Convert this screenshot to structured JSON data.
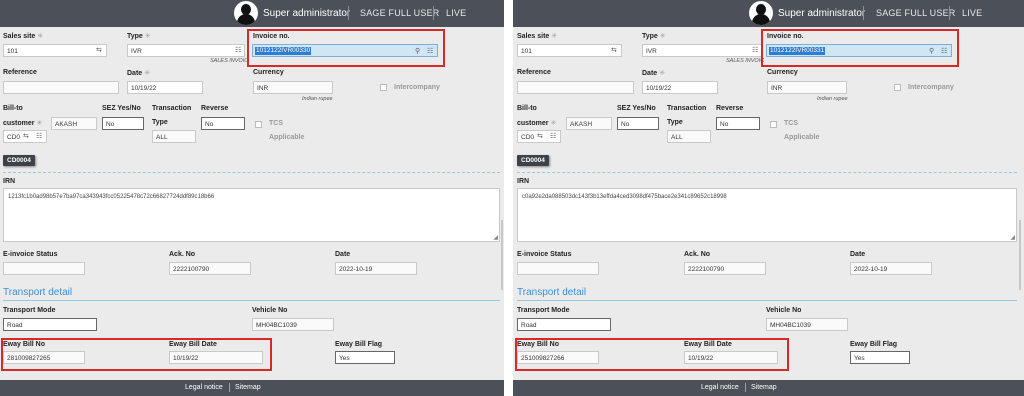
{
  "left": {
    "header": {
      "user": "Super administrator",
      "role": "SAGE FULL USER",
      "env": "LIVE"
    },
    "sales_site": {
      "label": "Sales site",
      "value": "101"
    },
    "type": {
      "label": "Type",
      "value": "IVR",
      "hint": "SALES INVOIC"
    },
    "invoice_no": {
      "label": "Invoice no.",
      "value": "1012122IVR00330"
    },
    "reference": {
      "label": "Reference",
      "value": ""
    },
    "date": {
      "label": "Date",
      "value": "10/19/22"
    },
    "currency": {
      "label": "Currency",
      "value": "INR",
      "hint": "Indian rupee"
    },
    "intercompany": {
      "label": "Intercompany"
    },
    "bill_to": {
      "label1": "Bill-to",
      "label2": "customer",
      "code": "CD0",
      "name": "AKASH"
    },
    "sez": {
      "label": "SEZ Yes/No",
      "value": "No"
    },
    "transaction_type": {
      "label1": "Transaction",
      "label2": "Type",
      "value": "ALL"
    },
    "reverse": {
      "label": "Reverse",
      "value": "No"
    },
    "tcs": {
      "label1": "TCS",
      "label2": "Applicable"
    },
    "customer_chip": "CD0004",
    "irn": {
      "label": "IRN",
      "value": "1213fc1b0ad98b57e7ba97ca343943fcc05225478c72c66827724ddf89c18b66"
    },
    "einvoice_status": {
      "label": "E-invoice Status",
      "value": ""
    },
    "ack_no": {
      "label": "Ack. No",
      "value": "2222100790"
    },
    "ack_date": {
      "label": "Date",
      "value": "2022-10-19"
    },
    "transport": {
      "title": "Transport detail"
    },
    "transport_mode": {
      "label": "Transport Mode",
      "value": "Road"
    },
    "vehicle_no": {
      "label": "Vehicle No",
      "value": "MH04BC1039"
    },
    "eway_bill_no": {
      "label": "Eway Bill No",
      "value": "281009827265"
    },
    "eway_bill_date": {
      "label": "Eway Bill Date",
      "value": "10/19/22"
    },
    "eway_bill_flag": {
      "label": "Eway Bill Flag",
      "value": "Yes"
    },
    "footer": {
      "legal": "Legal notice",
      "sitemap": "Sitemap"
    }
  },
  "right": {
    "header": {
      "user": "Super administrator",
      "role": "SAGE FULL USER",
      "env": "LIVE"
    },
    "sales_site": {
      "label": "Sales site",
      "value": "101"
    },
    "type": {
      "label": "Type",
      "value": "IVR",
      "hint": "SALES INVOIC"
    },
    "invoice_no": {
      "label": "Invoice no.",
      "value": "1012122IVR00331"
    },
    "reference": {
      "label": "Reference",
      "value": ""
    },
    "date": {
      "label": "Date",
      "value": "10/19/22"
    },
    "currency": {
      "label": "Currency",
      "value": "INR",
      "hint": "Indian rupee"
    },
    "intercompany": {
      "label": "Intercompany"
    },
    "bill_to": {
      "label1": "Bill-to",
      "label2": "customer",
      "code": "CD0",
      "name": "AKASH"
    },
    "sez": {
      "label": "SEZ Yes/No",
      "value": "No"
    },
    "transaction_type": {
      "label1": "Transaction",
      "label2": "Type",
      "value": "ALL"
    },
    "reverse": {
      "label": "Reverse",
      "value": "No"
    },
    "tcs": {
      "label1": "TCS",
      "label2": "Applicable"
    },
    "customer_chip": "CD0004",
    "irn": {
      "label": "IRN",
      "value": "c0a92e2da088503dc143f3b13effda4ced3098df475bace2e341c89652c18998"
    },
    "einvoice_status": {
      "label": "E-invoice Status",
      "value": ""
    },
    "ack_no": {
      "label": "Ack. No",
      "value": "2222100790"
    },
    "ack_date": {
      "label": "Date",
      "value": "2022-10-19"
    },
    "transport": {
      "title": "Transport detail"
    },
    "transport_mode": {
      "label": "Transport Mode",
      "value": "Road"
    },
    "vehicle_no": {
      "label": "Vehicle No",
      "value": "MH04BC1039"
    },
    "eway_bill_no": {
      "label": "Eway Bill No",
      "value": "251009827266"
    },
    "eway_bill_date": {
      "label": "Eway Bill Date",
      "value": "10/19/22"
    },
    "eway_bill_flag": {
      "label": "Eway Bill Flag",
      "value": "Yes"
    },
    "footer": {
      "legal": "Legal notice",
      "sitemap": "Sitemap"
    }
  },
  "theme": {
    "topbar": "#4c5058",
    "accent": "#3d8fd1",
    "highlight_border": "#d62a2a",
    "selection": "#2d7dd2"
  }
}
